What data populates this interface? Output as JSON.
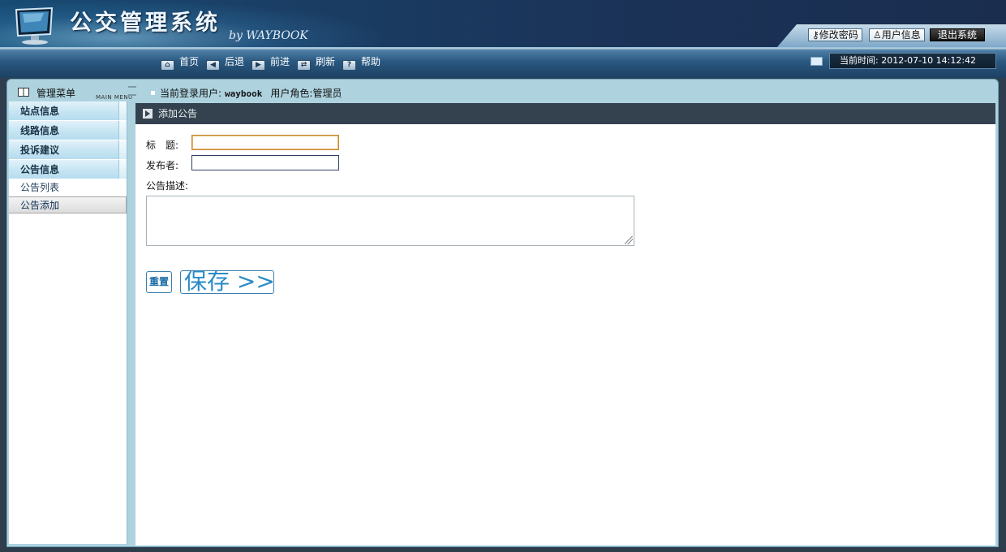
{
  "app": {
    "title": "公交管理系统",
    "byline": "by WAYBOOK"
  },
  "top_buttons": {
    "change_password": "修改密码",
    "user_info": "用户信息",
    "logout": "退出系统"
  },
  "nav": {
    "home": "首页",
    "back": "后退",
    "forward": "前进",
    "refresh": "刷新",
    "help": "帮助"
  },
  "clock": {
    "label": "当前时间:",
    "value": "2012-07-10 14:12:42"
  },
  "sidebar": {
    "title": "管理菜单",
    "subtitle": "MAIN MENU",
    "groups": [
      {
        "label": "站点信息"
      },
      {
        "label": "线路信息"
      },
      {
        "label": "投诉建议"
      },
      {
        "label": "公告信息"
      }
    ],
    "subitems": [
      {
        "label": "公告列表"
      },
      {
        "label": "公告添加",
        "active": true
      }
    ]
  },
  "login": {
    "user_label": "当前登录用户:",
    "user_value": "waybook",
    "role_label": "用户角色:",
    "role_value": "管理员"
  },
  "form": {
    "heading": "添加公告",
    "title_label": "标　题:",
    "title_value": "",
    "author_label": "发布者:",
    "author_value": "",
    "desc_label": "公告描述:",
    "desc_value": "",
    "reset_label": "重置",
    "save_label": "保存 >>"
  },
  "colors": {
    "header_dark": "#17304e",
    "frame": "#aed3df",
    "content_head": "#34424f",
    "accent_blue": "#2a8bc6"
  }
}
